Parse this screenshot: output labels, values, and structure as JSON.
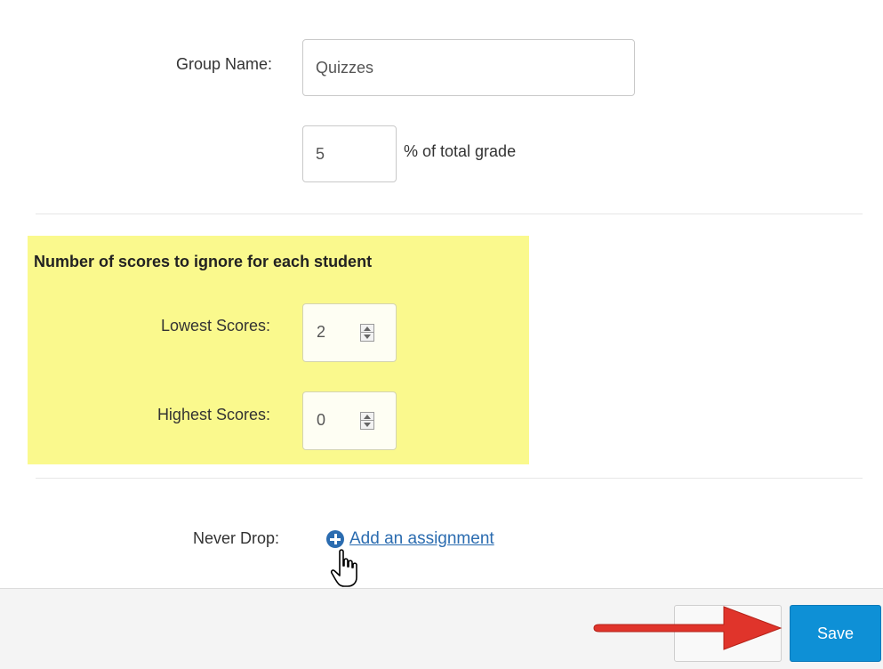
{
  "form": {
    "group_name_label": "Group Name:",
    "group_name_value": "Quizzes",
    "weight_value": "5",
    "weight_suffix": "% of total grade"
  },
  "drop_rules": {
    "section_title": "Number of scores to ignore for each student",
    "lowest_label": "Lowest Scores:",
    "lowest_value": "2",
    "highest_label": "Highest Scores:",
    "highest_value": "0",
    "highlight_color": "#faf98d"
  },
  "never_drop": {
    "label": "Never Drop:",
    "link_label": "Add an assignment",
    "icon": "plus-circle-icon"
  },
  "footer": {
    "cancel_label": "",
    "save_label": "Save",
    "save_color": "#0e90d6",
    "annotation_color": "#e0342b"
  }
}
